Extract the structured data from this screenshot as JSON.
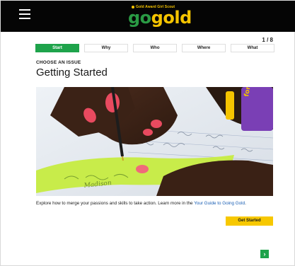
{
  "header": {
    "logo_tagline": "Gold Award Girl Scout",
    "logo_go": "go",
    "logo_gold": "gold"
  },
  "progress": {
    "label": "1 / 8",
    "current": 1,
    "total": 8
  },
  "steps": [
    {
      "label": "Start",
      "active": true
    },
    {
      "label": "Why",
      "active": false
    },
    {
      "label": "Who",
      "active": false
    },
    {
      "label": "Where",
      "active": false
    },
    {
      "label": "What",
      "active": false
    }
  ],
  "section": {
    "kicker": "CHOOSE AN ISSUE",
    "title": "Getting Started",
    "image_note": "Madison"
  },
  "description": {
    "text": "Explore how to merge your passions and skills to take action. Learn more in the ",
    "link": "Your Guide to Going Gold",
    "end": "."
  },
  "cta_label": "Get Started",
  "next_icon": "chevron-right-icon",
  "colors": {
    "accent_green": "#1ea34b",
    "accent_gold": "#f7c800",
    "topbar": "#050505",
    "link": "#1a5fb4"
  }
}
